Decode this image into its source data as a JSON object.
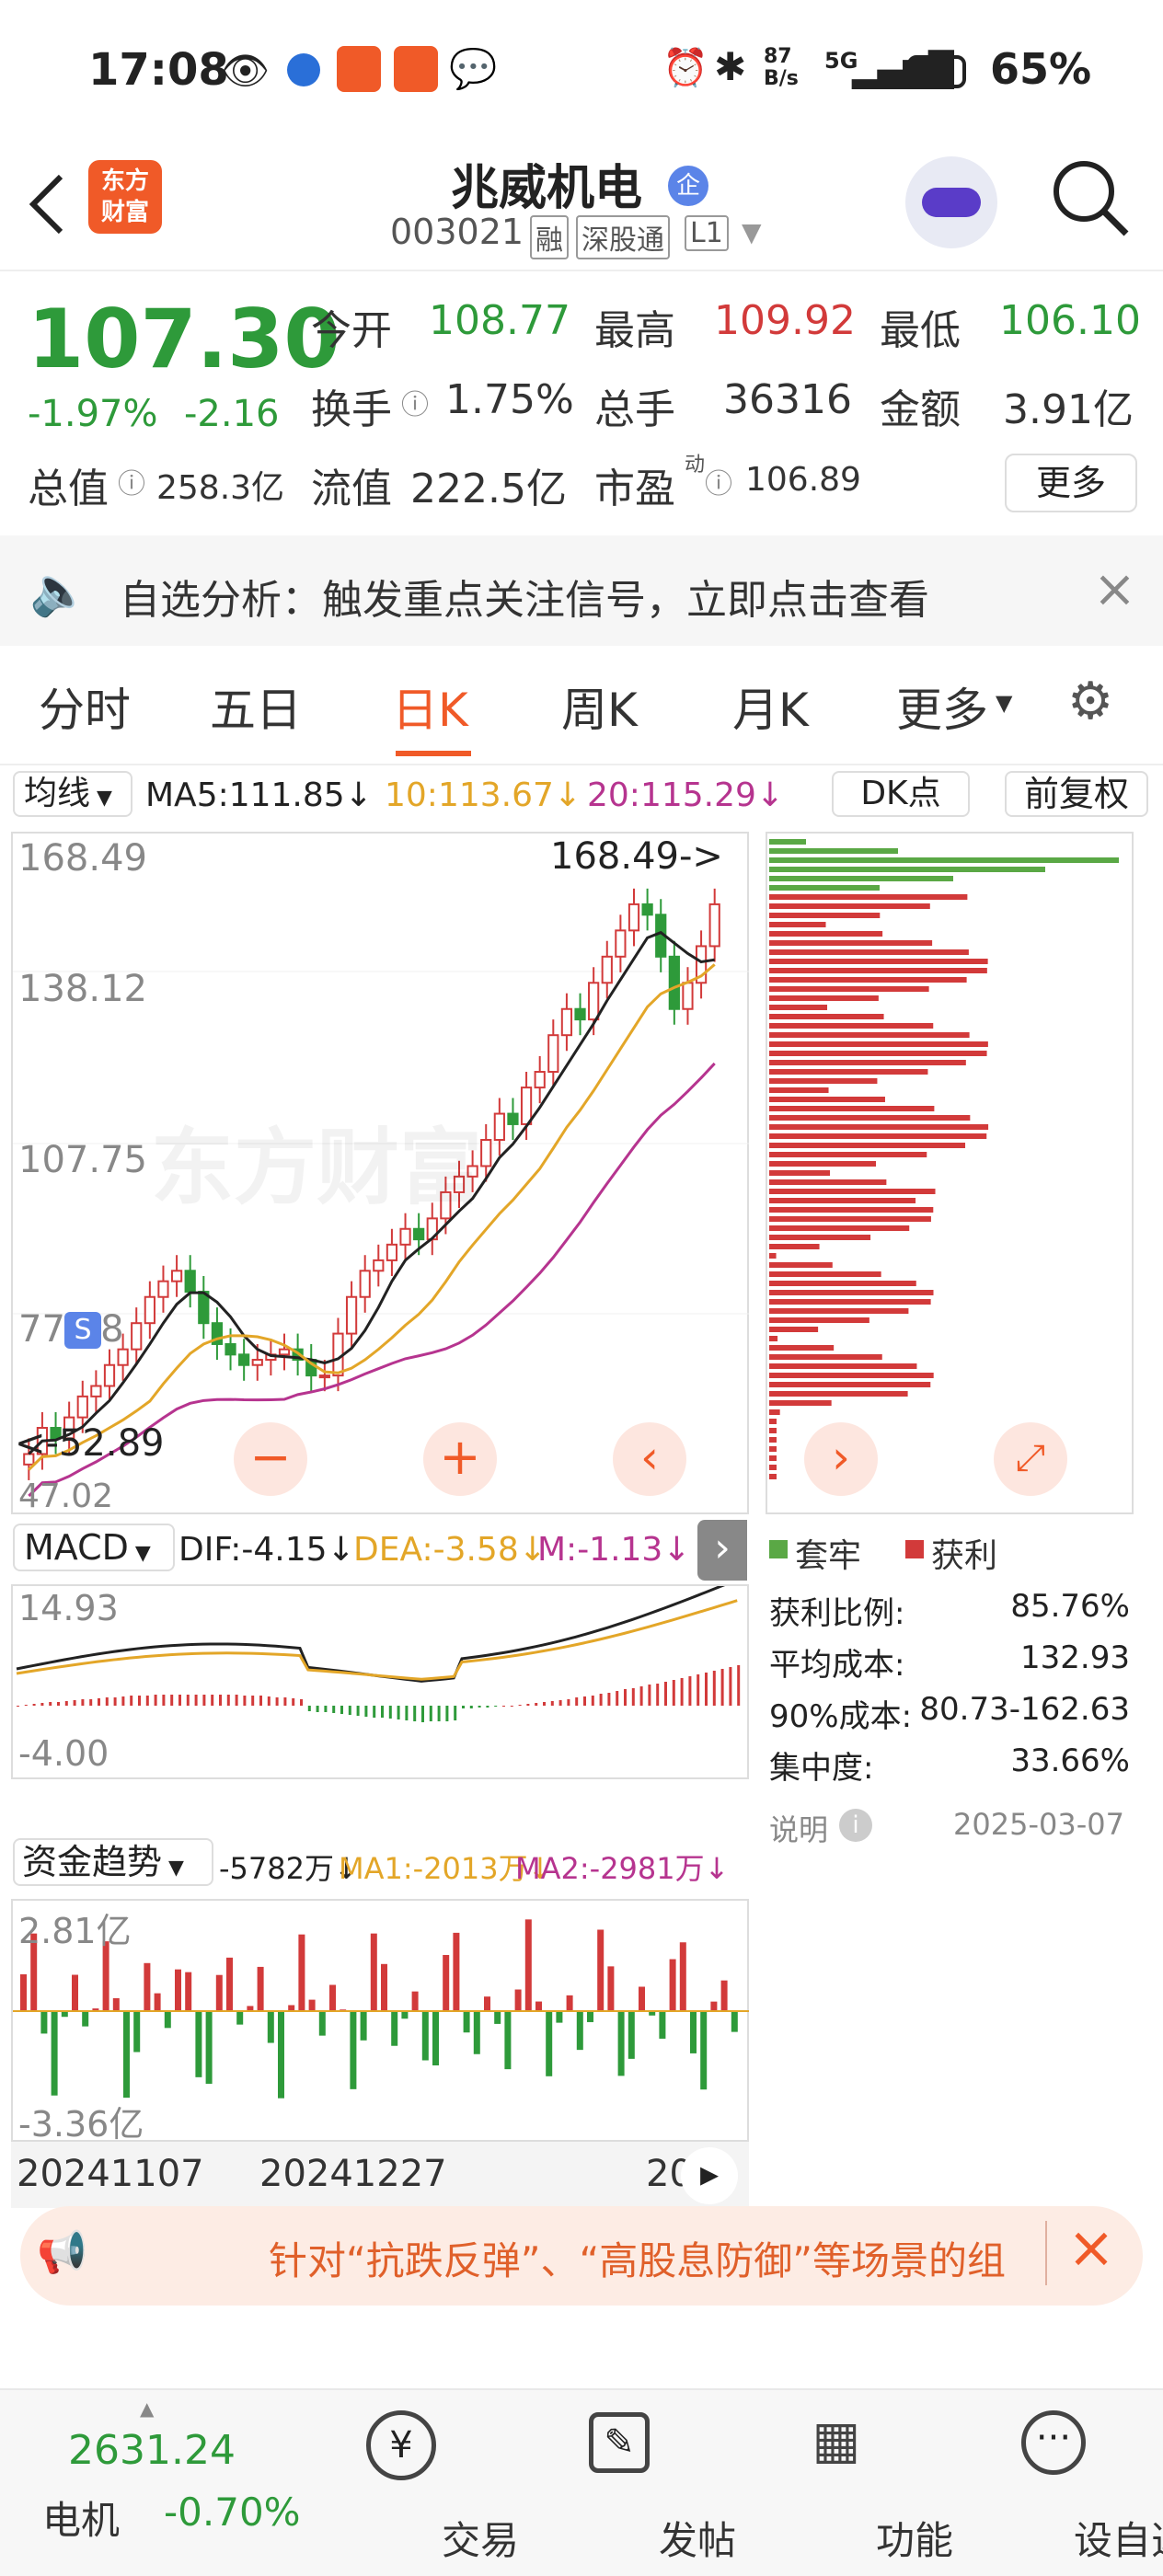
{
  "status": {
    "time": "17:08",
    "net_speed_top": "87",
    "net_speed_bottom": "B/s",
    "network": "5G",
    "battery": "65%"
  },
  "header": {
    "app_logo_line1": "东方",
    "app_logo_line2": "财富",
    "stock_name": "兆威机电",
    "badge": "企",
    "code": "003021",
    "tags": [
      "融",
      "深股通",
      "L1"
    ]
  },
  "quote": {
    "price": "107.30",
    "change_pct": "-1.97%",
    "change": "-2.16",
    "open_label": "今开",
    "open": "108.77",
    "high_label": "最高",
    "high": "109.92",
    "low_label": "最低",
    "low": "106.10",
    "turnover_label": "换手",
    "turnover": "1.75%",
    "volume_label": "总手",
    "volume": "36316",
    "amount_label": "金额",
    "amount": "3.91亿",
    "mcap_label": "总值",
    "mcap": "258.3亿",
    "float_label": "流值",
    "float": "222.5亿",
    "pe_label": "市盈",
    "pe_sup": "动",
    "pe": "106.89",
    "more": "更多"
  },
  "alert": {
    "text": "自选分析：触发重点关注信号，立即点击查看"
  },
  "tabs": [
    "分时",
    "五日",
    "日K",
    "周K",
    "月K",
    "更多",
    "⚙"
  ],
  "ma": {
    "selector": "均线",
    "ma5": "MA5:111.85↓",
    "ma10": "10:113.67↓",
    "ma20": "20:115.29↓",
    "dk": "DK点",
    "fq": "前复权"
  },
  "kline": {
    "y_labels": [
      "168.49",
      "138.12",
      "107.75",
      "77.38",
      "47.02"
    ],
    "max_marker": "168.49->",
    "min_marker": "<-52.89",
    "watermark": "东方财富"
  },
  "kline_prices": {
    "closes": [
      55,
      60,
      58,
      62,
      66,
      68,
      72,
      75,
      80,
      85,
      88,
      90,
      86,
      80,
      76,
      74,
      72,
      73,
      74,
      75,
      73,
      70,
      70,
      78,
      85,
      90,
      92,
      95,
      98,
      96,
      100,
      105,
      108,
      110,
      115,
      120,
      118,
      125,
      128,
      135,
      140,
      138,
      145,
      150,
      155,
      160,
      158,
      150,
      140,
      145,
      152,
      160
    ]
  },
  "macd": {
    "selector": "MACD",
    "dif": "DIF:-4.15↓",
    "dea": "DEA:-3.58↓",
    "m": "M:-1.13↓",
    "y_top": "14.93",
    "y_bottom": "-4.00"
  },
  "fund": {
    "selector": "资金趋势",
    "value": "-5782万↓",
    "ma1": "MA1:-2013万↓",
    "ma2": "MA2:-2981万↓",
    "y_top": "2.81亿",
    "y_bottom": "-3.36亿"
  },
  "dates": [
    "20241107",
    "20241227",
    "20"
  ],
  "chip": {
    "legend_trapped": "套牢",
    "legend_profit": "获利",
    "rows": [
      {
        "k": "获利比例:",
        "v": "85.76%"
      },
      {
        "k": "平均成本:",
        "v": "132.93"
      },
      {
        "k": "90%成本:",
        "v": "80.73-162.63"
      },
      {
        "k": "集中度:",
        "v": "33.66%"
      }
    ],
    "note": "说明",
    "date": "2025-03-07"
  },
  "banner": {
    "text": "针对“抗跌反弹”、“高股息防御”等场景的组"
  },
  "bottom": {
    "index_value": "2631.24",
    "index_name": "电机",
    "index_change": "-0.70%",
    "items": [
      "交易",
      "发帖",
      "功能",
      "设自选"
    ]
  },
  "colors": {
    "up": "#d23a3a",
    "down": "#2e9a3a",
    "ma10": "#e3a628",
    "ma20": "#b6348f",
    "accent": "#f05a28"
  }
}
